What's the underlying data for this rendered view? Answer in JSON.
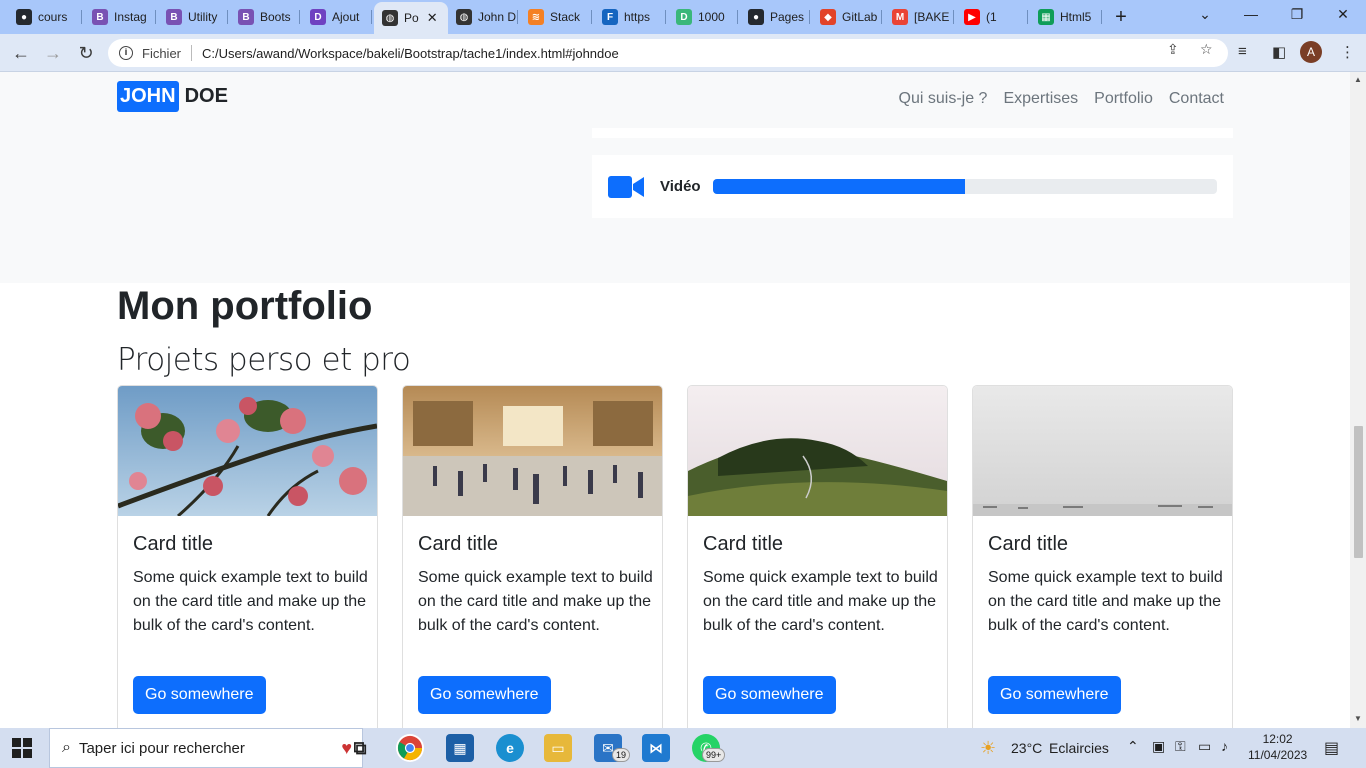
{
  "browser": {
    "tabs": [
      {
        "label": "cours",
        "icon": "github-icon",
        "color": "#24292f"
      },
      {
        "label": "Instag",
        "icon": "bootstrap-icon",
        "color": "#7952b3"
      },
      {
        "label": "Utility",
        "icon": "bootstrap-icon",
        "color": "#7952b3"
      },
      {
        "label": "Boots",
        "icon": "bootstrap-icon",
        "color": "#7952b3"
      },
      {
        "label": "Ajout",
        "icon": "d-icon",
        "color": "#6f42c1"
      },
      {
        "label": "Po",
        "icon": "globe-icon",
        "color": "#333333",
        "active": true
      },
      {
        "label": "John D",
        "icon": "globe-icon",
        "color": "#333333"
      },
      {
        "label": "Stack",
        "icon": "stackoverflow-icon",
        "color": "#f48024"
      },
      {
        "label": "https",
        "icon": "f-icon",
        "color": "#1565c0"
      },
      {
        "label": "1000",
        "icon": "d-icon",
        "color": "#3ab77a"
      },
      {
        "label": "Pages",
        "icon": "github-icon",
        "color": "#24292f"
      },
      {
        "label": "GitLab",
        "icon": "gitlab-icon",
        "color": "#e24329"
      },
      {
        "label": "[BAKE",
        "icon": "gmail-icon",
        "color": "#ea4335"
      },
      {
        "label": "(1",
        "icon": "youtube-icon",
        "color": "#ff0000"
      },
      {
        "label": "Html5",
        "icon": "sheet-icon",
        "color": "#0f9d58"
      }
    ],
    "scheme_label": "Fichier",
    "url": "C:/Users/awand/Workspace/bakeli/Bootstrap/tache1/index.html#johndoe",
    "profile_initial": "A"
  },
  "page": {
    "brand": {
      "first": "JOHN",
      "last": "DOE"
    },
    "nav": [
      "Qui suis-je ?",
      "Expertises",
      "Portfolio",
      "Contact"
    ],
    "skill": {
      "label": "Vidéo",
      "progress": 0.5
    },
    "portfolio": {
      "title": "Mon portfolio",
      "subtitle": "Projets perso et pro",
      "cards": [
        {
          "image": "pink-flowers-photo",
          "title": "Card title",
          "text": "Some quick example text to build on the card title and make up the bulk of the card's content.",
          "button": "Go somewhere"
        },
        {
          "image": "train-station-photo",
          "title": "Card title",
          "text": "Some quick example text to build on the card title and make up the bulk of the card's content.",
          "button": "Go somewhere"
        },
        {
          "image": "green-hills-photo",
          "title": "Card title",
          "text": "Some quick example text to build on the card title and make up the bulk of the card's content.",
          "button": "Go somewhere"
        },
        {
          "image": "misty-sea-photo",
          "title": "Card title",
          "text": "Some quick example text to build on the card title and make up the bulk of the card's content.",
          "button": "Go somewhere"
        }
      ]
    }
  },
  "taskbar": {
    "search_placeholder": "Taper ici pour rechercher",
    "mail_badge": "19",
    "whatsapp_badge": "99+",
    "weather": {
      "temp": "23°C",
      "condition": "Eclaircies"
    },
    "time": "12:02",
    "date": "11/04/2023"
  },
  "colors": {
    "primary": "#0d6efd",
    "tabstrip": "#a8c7fa",
    "toolbar": "#dfe8f6"
  }
}
